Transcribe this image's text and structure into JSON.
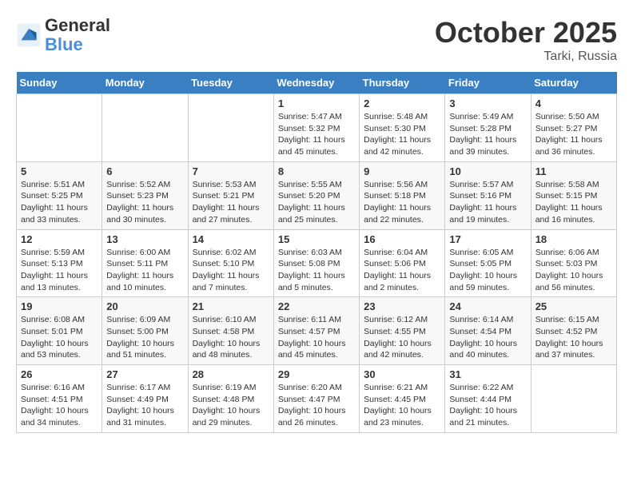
{
  "header": {
    "logo_line1": "General",
    "logo_line2": "Blue",
    "month": "October 2025",
    "location": "Tarki, Russia"
  },
  "weekdays": [
    "Sunday",
    "Monday",
    "Tuesday",
    "Wednesday",
    "Thursday",
    "Friday",
    "Saturday"
  ],
  "weeks": [
    [
      {
        "day": "",
        "info": ""
      },
      {
        "day": "",
        "info": ""
      },
      {
        "day": "",
        "info": ""
      },
      {
        "day": "1",
        "info": "Sunrise: 5:47 AM\nSunset: 5:32 PM\nDaylight: 11 hours\nand 45 minutes."
      },
      {
        "day": "2",
        "info": "Sunrise: 5:48 AM\nSunset: 5:30 PM\nDaylight: 11 hours\nand 42 minutes."
      },
      {
        "day": "3",
        "info": "Sunrise: 5:49 AM\nSunset: 5:28 PM\nDaylight: 11 hours\nand 39 minutes."
      },
      {
        "day": "4",
        "info": "Sunrise: 5:50 AM\nSunset: 5:27 PM\nDaylight: 11 hours\nand 36 minutes."
      }
    ],
    [
      {
        "day": "5",
        "info": "Sunrise: 5:51 AM\nSunset: 5:25 PM\nDaylight: 11 hours\nand 33 minutes."
      },
      {
        "day": "6",
        "info": "Sunrise: 5:52 AM\nSunset: 5:23 PM\nDaylight: 11 hours\nand 30 minutes."
      },
      {
        "day": "7",
        "info": "Sunrise: 5:53 AM\nSunset: 5:21 PM\nDaylight: 11 hours\nand 27 minutes."
      },
      {
        "day": "8",
        "info": "Sunrise: 5:55 AM\nSunset: 5:20 PM\nDaylight: 11 hours\nand 25 minutes."
      },
      {
        "day": "9",
        "info": "Sunrise: 5:56 AM\nSunset: 5:18 PM\nDaylight: 11 hours\nand 22 minutes."
      },
      {
        "day": "10",
        "info": "Sunrise: 5:57 AM\nSunset: 5:16 PM\nDaylight: 11 hours\nand 19 minutes."
      },
      {
        "day": "11",
        "info": "Sunrise: 5:58 AM\nSunset: 5:15 PM\nDaylight: 11 hours\nand 16 minutes."
      }
    ],
    [
      {
        "day": "12",
        "info": "Sunrise: 5:59 AM\nSunset: 5:13 PM\nDaylight: 11 hours\nand 13 minutes."
      },
      {
        "day": "13",
        "info": "Sunrise: 6:00 AM\nSunset: 5:11 PM\nDaylight: 11 hours\nand 10 minutes."
      },
      {
        "day": "14",
        "info": "Sunrise: 6:02 AM\nSunset: 5:10 PM\nDaylight: 11 hours\nand 7 minutes."
      },
      {
        "day": "15",
        "info": "Sunrise: 6:03 AM\nSunset: 5:08 PM\nDaylight: 11 hours\nand 5 minutes."
      },
      {
        "day": "16",
        "info": "Sunrise: 6:04 AM\nSunset: 5:06 PM\nDaylight: 11 hours\nand 2 minutes."
      },
      {
        "day": "17",
        "info": "Sunrise: 6:05 AM\nSunset: 5:05 PM\nDaylight: 10 hours\nand 59 minutes."
      },
      {
        "day": "18",
        "info": "Sunrise: 6:06 AM\nSunset: 5:03 PM\nDaylight: 10 hours\nand 56 minutes."
      }
    ],
    [
      {
        "day": "19",
        "info": "Sunrise: 6:08 AM\nSunset: 5:01 PM\nDaylight: 10 hours\nand 53 minutes."
      },
      {
        "day": "20",
        "info": "Sunrise: 6:09 AM\nSunset: 5:00 PM\nDaylight: 10 hours\nand 51 minutes."
      },
      {
        "day": "21",
        "info": "Sunrise: 6:10 AM\nSunset: 4:58 PM\nDaylight: 10 hours\nand 48 minutes."
      },
      {
        "day": "22",
        "info": "Sunrise: 6:11 AM\nSunset: 4:57 PM\nDaylight: 10 hours\nand 45 minutes."
      },
      {
        "day": "23",
        "info": "Sunrise: 6:12 AM\nSunset: 4:55 PM\nDaylight: 10 hours\nand 42 minutes."
      },
      {
        "day": "24",
        "info": "Sunrise: 6:14 AM\nSunset: 4:54 PM\nDaylight: 10 hours\nand 40 minutes."
      },
      {
        "day": "25",
        "info": "Sunrise: 6:15 AM\nSunset: 4:52 PM\nDaylight: 10 hours\nand 37 minutes."
      }
    ],
    [
      {
        "day": "26",
        "info": "Sunrise: 6:16 AM\nSunset: 4:51 PM\nDaylight: 10 hours\nand 34 minutes."
      },
      {
        "day": "27",
        "info": "Sunrise: 6:17 AM\nSunset: 4:49 PM\nDaylight: 10 hours\nand 31 minutes."
      },
      {
        "day": "28",
        "info": "Sunrise: 6:19 AM\nSunset: 4:48 PM\nDaylight: 10 hours\nand 29 minutes."
      },
      {
        "day": "29",
        "info": "Sunrise: 6:20 AM\nSunset: 4:47 PM\nDaylight: 10 hours\nand 26 minutes."
      },
      {
        "day": "30",
        "info": "Sunrise: 6:21 AM\nSunset: 4:45 PM\nDaylight: 10 hours\nand 23 minutes."
      },
      {
        "day": "31",
        "info": "Sunrise: 6:22 AM\nSunset: 4:44 PM\nDaylight: 10 hours\nand 21 minutes."
      },
      {
        "day": "",
        "info": ""
      }
    ]
  ]
}
